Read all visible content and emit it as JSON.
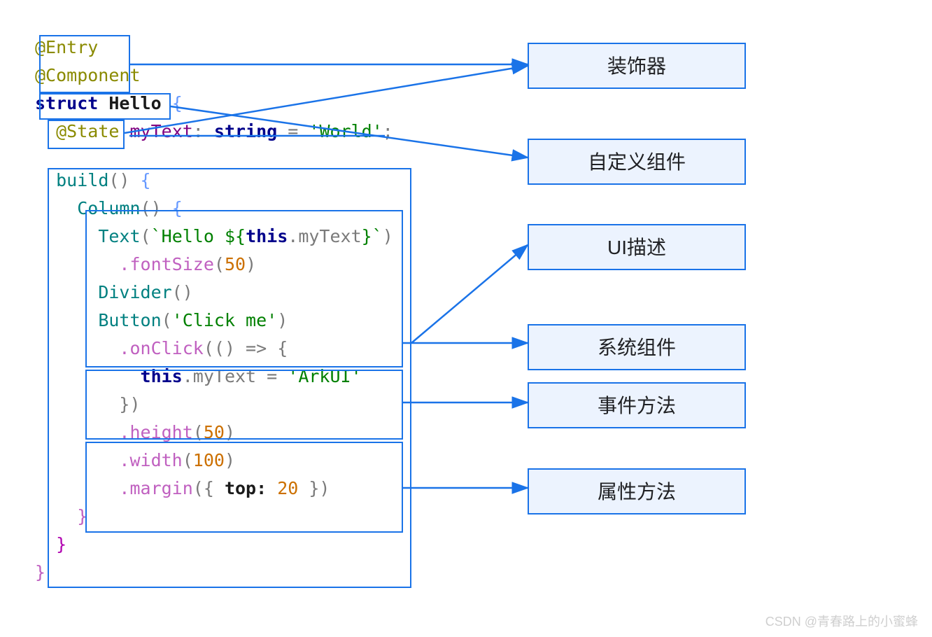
{
  "code": {
    "entry": "@Entry",
    "component": "@Component",
    "struct": "struct",
    "hello": "Hello",
    "state": "@State",
    "myText": "myText",
    "stringType": "string",
    "assignWorld": "'World'",
    "build": "build",
    "column": "Column",
    "text": "Text",
    "helloTmplStart": "`Hello ${",
    "this": "this",
    "dotMyText": ".myText",
    "helloTmplEnd": "}`",
    "fontSize": ".fontSize",
    "fifty": "50",
    "divider": "Divider",
    "button": "Button",
    "clickMe": "'Click me'",
    "onClick": ".onClick",
    "arrowStart": "(() => {",
    "thisMyText": "this.myText",
    "arkui": "'ArkUI'",
    "arrowEnd": "})",
    "height": ".height",
    "width": ".width",
    "hundred": "100",
    "margin": ".margin",
    "marginArg": "({ ",
    "top": "top:",
    "twenty": "20",
    "marginArgEnd": " })"
  },
  "labels": {
    "decorator": "装饰器",
    "customComp": "自定义组件",
    "uiDesc": "UI描述",
    "sysComp": "系统组件",
    "eventMethod": "事件方法",
    "attrMethod": "属性方法"
  },
  "watermark": "CSDN @青春路上的小蜜蜂"
}
